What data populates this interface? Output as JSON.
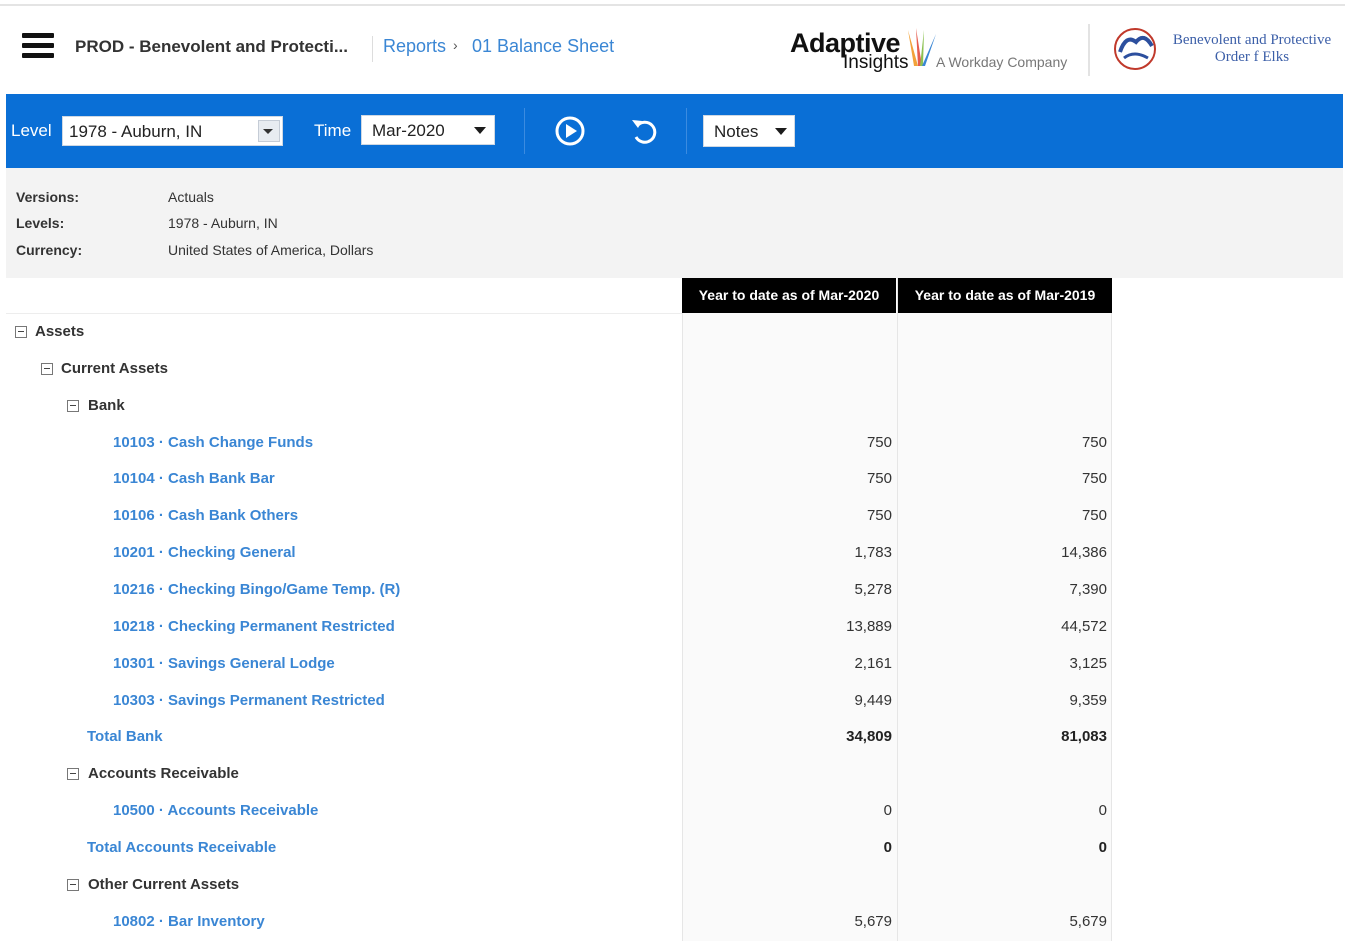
{
  "header": {
    "app_title": "PROD - Benevolent and Protecti...",
    "breadcrumb": [
      "Reports",
      "01 Balance Sheet"
    ],
    "breadcrumb_separator": "›",
    "vendor_logo": {
      "name": "Adaptive",
      "sub": "Insights",
      "tagline": "A Workday Company"
    },
    "org_logo": {
      "line1": "Benevolent and Protective",
      "line2": "Order f Elks"
    }
  },
  "toolbar": {
    "level_label": "Level",
    "level_value": "1978 - Auburn, IN",
    "time_label": "Time",
    "time_value": "Mar-2020",
    "notes_label": "Notes",
    "colors": {
      "bar": "#0a6fd6"
    }
  },
  "info": {
    "rows": [
      {
        "key": "Versions:",
        "value": "Actuals"
      },
      {
        "key": "Levels:",
        "value": "1978 - Auburn, IN"
      },
      {
        "key": "Currency:",
        "value": "United States of America, Dollars"
      }
    ]
  },
  "report": {
    "columns": [
      "Year to date as of Mar-2020",
      "Year to date as of Mar-2019"
    ],
    "rows": [
      {
        "type": "group",
        "label": "Assets",
        "indent": 0
      },
      {
        "type": "group",
        "label": "Current Assets",
        "indent": 1
      },
      {
        "type": "group",
        "label": "Bank",
        "indent": 2
      },
      {
        "type": "account",
        "label": "10103 · Cash Change Funds",
        "v1": "750",
        "v2": "750"
      },
      {
        "type": "account",
        "label": "10104 · Cash Bank Bar",
        "v1": "750",
        "v2": "750"
      },
      {
        "type": "account",
        "label": "10106 · Cash Bank Others",
        "v1": "750",
        "v2": "750"
      },
      {
        "type": "account",
        "label": "10201 · Checking General",
        "v1": "1,783",
        "v2": "14,386"
      },
      {
        "type": "account",
        "label": "10216 · Checking Bingo/Game Temp. (R)",
        "v1": "5,278",
        "v2": "7,390"
      },
      {
        "type": "account",
        "label": "10218 · Checking Permanent Restricted",
        "v1": "13,889",
        "v2": "44,572"
      },
      {
        "type": "account",
        "label": "10301 · Savings General Lodge",
        "v1": "2,161",
        "v2": "3,125"
      },
      {
        "type": "account",
        "label": "10303 · Savings Permanent Restricted",
        "v1": "9,449",
        "v2": "9,359"
      },
      {
        "type": "total",
        "label": "Total Bank",
        "v1": "34,809",
        "v2": "81,083"
      },
      {
        "type": "group",
        "label": "Accounts Receivable",
        "indent": 2
      },
      {
        "type": "account",
        "label": "10500 · Accounts Receivable",
        "v1": "0",
        "v2": "0"
      },
      {
        "type": "total",
        "label": "Total Accounts Receivable",
        "v1": "0",
        "v2": "0"
      },
      {
        "type": "group",
        "label": "Other Current Assets",
        "indent": 2
      },
      {
        "type": "account",
        "label": "10802 · Bar Inventory",
        "v1": "5,679",
        "v2": "5,679"
      }
    ]
  }
}
